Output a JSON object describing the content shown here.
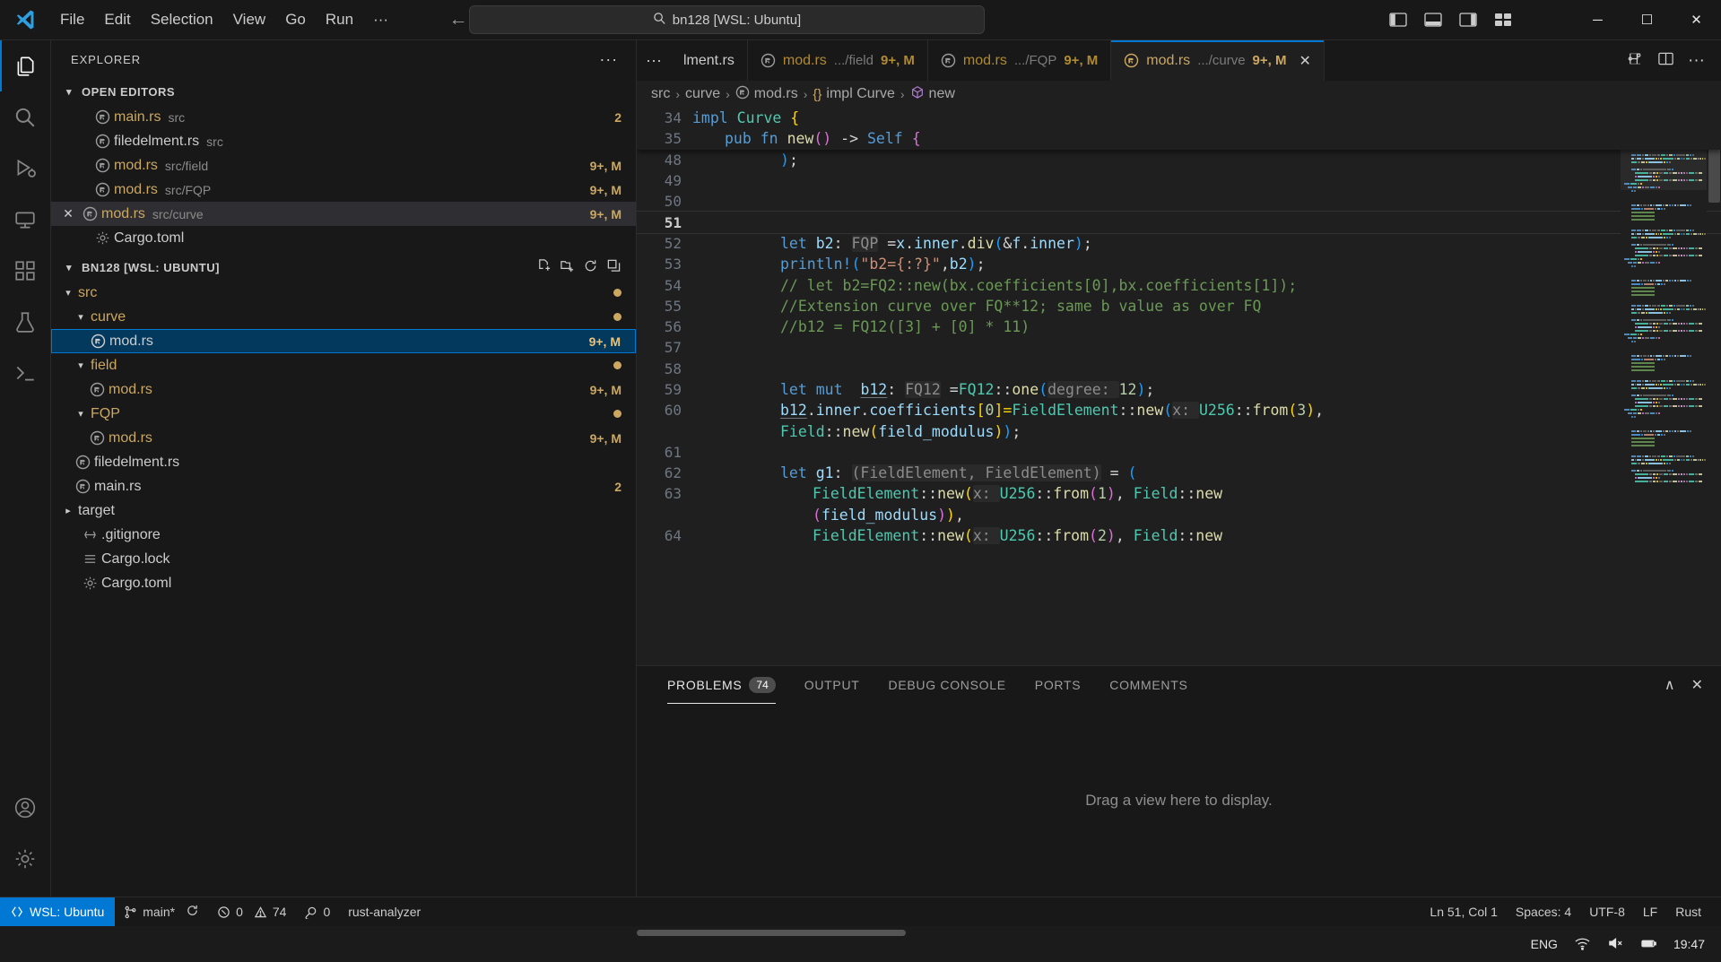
{
  "titlebar": {
    "menus": [
      "File",
      "Edit",
      "Selection",
      "View",
      "Go",
      "Run",
      "···"
    ],
    "back_icon": "←",
    "forward_icon": "→",
    "search_placeholder": "bn128 [WSL: Ubuntu]",
    "search_value": "bn128 [WSL: Ubuntu]",
    "minimize": "─",
    "maximize": "☐",
    "close": "✕"
  },
  "activitybar": {
    "items": [
      {
        "name": "explorer",
        "icon": "files-icon",
        "active": true
      },
      {
        "name": "search",
        "icon": "search-icon",
        "active": false
      },
      {
        "name": "run-and-debug",
        "icon": "debug-icon",
        "active": false
      },
      {
        "name": "remote-explorer",
        "icon": "remote-icon",
        "active": false
      },
      {
        "name": "extensions",
        "icon": "extensions-icon",
        "active": false
      },
      {
        "name": "testing",
        "icon": "beaker-icon",
        "active": false
      },
      {
        "name": "terminal",
        "icon": "terminal-icon",
        "active": false
      }
    ],
    "bottom": [
      {
        "name": "accounts",
        "icon": "account-icon"
      },
      {
        "name": "manage",
        "icon": "gear-icon"
      }
    ]
  },
  "sidebar": {
    "title": "EXPLORER",
    "more_actions": "···",
    "open_editors": {
      "label": "OPEN EDITORS",
      "items": [
        {
          "name": "main.rs",
          "path": "src",
          "badge": "2",
          "selected": false,
          "dirty": false
        },
        {
          "name": "filedelment.rs",
          "path": "src",
          "badge": "",
          "selected": false,
          "dirty": false
        },
        {
          "name": "mod.rs",
          "path": "src/field",
          "badge": "9+, M",
          "selected": false,
          "dirty": false
        },
        {
          "name": "mod.rs",
          "path": "src/FQP",
          "badge": "9+, M",
          "selected": false,
          "dirty": false
        },
        {
          "name": "mod.rs",
          "path": "src/curve",
          "badge": "9+, M",
          "selected": true,
          "dirty": false
        },
        {
          "name": "Cargo.toml",
          "path": "",
          "badge": "",
          "selected": false,
          "dirty": false
        }
      ]
    },
    "workspace": {
      "label": "BN128 [WSL: UBUNTU]",
      "actions": [
        "new-file-icon",
        "new-folder-icon",
        "refresh-icon",
        "collapse-all-icon"
      ],
      "tree": [
        {
          "name": "src",
          "type": "folder",
          "depth": 0,
          "expanded": true,
          "badge": "",
          "dot": true,
          "selected": false
        },
        {
          "name": "curve",
          "type": "folder",
          "depth": 1,
          "expanded": true,
          "badge": "",
          "dot": true,
          "selected": false
        },
        {
          "name": "mod.rs",
          "type": "file",
          "depth": 2,
          "expanded": false,
          "badge": "9+, M",
          "dot": false,
          "selected": true
        },
        {
          "name": "field",
          "type": "folder",
          "depth": 1,
          "expanded": true,
          "badge": "",
          "dot": true,
          "selected": false
        },
        {
          "name": "mod.rs",
          "type": "file",
          "depth": 2,
          "expanded": false,
          "badge": "9+, M",
          "dot": false,
          "selected": false
        },
        {
          "name": "FQP",
          "type": "folder",
          "depth": 1,
          "expanded": true,
          "badge": "",
          "dot": true,
          "selected": false
        },
        {
          "name": "mod.rs",
          "type": "file",
          "depth": 2,
          "expanded": false,
          "badge": "9+, M",
          "dot": false,
          "selected": false
        },
        {
          "name": "filedelment.rs",
          "type": "file",
          "depth": 1,
          "expanded": false,
          "badge": "",
          "dot": false,
          "selected": false
        },
        {
          "name": "main.rs",
          "type": "file",
          "depth": 1,
          "expanded": false,
          "badge": "2",
          "dot": false,
          "selected": false
        },
        {
          "name": "target",
          "type": "folder",
          "depth": 0,
          "expanded": false,
          "badge": "",
          "dot": false,
          "selected": false
        },
        {
          "name": ".gitignore",
          "type": "git",
          "depth": 0,
          "expanded": false,
          "badge": "",
          "dot": false,
          "selected": false
        },
        {
          "name": "Cargo.lock",
          "type": "lock",
          "depth": 0,
          "expanded": false,
          "badge": "",
          "dot": false,
          "selected": false
        },
        {
          "name": "Cargo.toml",
          "type": "toml",
          "depth": 0,
          "expanded": false,
          "badge": "",
          "dot": false,
          "selected": false
        }
      ]
    }
  },
  "tabs": {
    "overflow_icon": "···",
    "items": [
      {
        "name": "lment.rs",
        "path": "",
        "badge": "",
        "active": false,
        "truncated": true
      },
      {
        "name": "mod.rs",
        "path": ".../field",
        "badge": "9+, M",
        "active": false,
        "truncated": false
      },
      {
        "name": "mod.rs",
        "path": ".../FQP",
        "badge": "9+, M",
        "active": false,
        "truncated": false
      },
      {
        "name": "mod.rs",
        "path": ".../curve",
        "badge": "9+, M",
        "active": true,
        "truncated": false
      }
    ],
    "actions": [
      "split-editor-icon",
      "editor-layout-icon",
      "more-actions-icon"
    ],
    "close_icon": "✕"
  },
  "breadcrumb": {
    "items": [
      {
        "label": "src",
        "icon": ""
      },
      {
        "label": "curve",
        "icon": ""
      },
      {
        "label": "mod.rs",
        "icon": "rust-icon"
      },
      {
        "label": "impl Curve",
        "icon": "braces-icon"
      },
      {
        "label": "new",
        "icon": "method-icon"
      }
    ],
    "separator": "›"
  },
  "editor": {
    "sticky_lines": [
      {
        "num": "34",
        "indent": 0,
        "tokens": [
          {
            "t": "impl ",
            "c": "kw"
          },
          {
            "t": "Curve",
            "c": "ty"
          },
          {
            "t": " ",
            "c": "op"
          },
          {
            "t": "{",
            "c": "pn1"
          }
        ]
      },
      {
        "num": "35",
        "indent": 1,
        "tokens": [
          {
            "t": "pub ",
            "c": "kw"
          },
          {
            "t": "fn ",
            "c": "kw"
          },
          {
            "t": "new",
            "c": "fn"
          },
          {
            "t": "()",
            "c": "pn2"
          },
          {
            "t": " -> ",
            "c": "op"
          },
          {
            "t": "Self",
            "c": "kw"
          },
          {
            "t": " ",
            "c": "op"
          },
          {
            "t": "{",
            "c": "pn2"
          }
        ]
      }
    ],
    "lines": [
      {
        "num": "48",
        "git": true,
        "current": false,
        "indent": 2,
        "tokens": [
          {
            "t": ")",
            "c": "pn3"
          },
          {
            "t": ";",
            "c": "op"
          }
        ]
      },
      {
        "num": "49",
        "git": true,
        "current": false,
        "indent": 2,
        "tokens": []
      },
      {
        "num": "50",
        "git": true,
        "current": false,
        "indent": 2,
        "tokens": []
      },
      {
        "num": "51",
        "git": false,
        "current": true,
        "indent": 2,
        "tokens": []
      },
      {
        "num": "52",
        "git": true,
        "current": false,
        "indent": 2,
        "tokens": [
          {
            "t": "let ",
            "c": "kw"
          },
          {
            "t": "b2",
            "c": "var"
          },
          {
            "t": ": ",
            "c": "op"
          },
          {
            "t": "FQP",
            "c": "hint"
          },
          {
            "t": " =",
            "c": "op"
          },
          {
            "t": "x",
            "c": "var"
          },
          {
            "t": ".",
            "c": "op"
          },
          {
            "t": "inner",
            "c": "var"
          },
          {
            "t": ".",
            "c": "op"
          },
          {
            "t": "div",
            "c": "fn"
          },
          {
            "t": "(",
            "c": "pn3"
          },
          {
            "t": "&",
            "c": "op"
          },
          {
            "t": "f",
            "c": "var"
          },
          {
            "t": ".",
            "c": "op"
          },
          {
            "t": "inner",
            "c": "var"
          },
          {
            "t": ")",
            "c": "pn3"
          },
          {
            "t": ";",
            "c": "op"
          }
        ]
      },
      {
        "num": "53",
        "git": true,
        "current": false,
        "indent": 2,
        "tokens": [
          {
            "t": "println!",
            "c": "mac"
          },
          {
            "t": "(",
            "c": "pn3"
          },
          {
            "t": "\"b2={:?}\"",
            "c": "str"
          },
          {
            "t": ",",
            "c": "op"
          },
          {
            "t": "b2",
            "c": "var"
          },
          {
            "t": ")",
            "c": "pn3"
          },
          {
            "t": ";",
            "c": "op"
          }
        ]
      },
      {
        "num": "54",
        "git": true,
        "current": false,
        "indent": 2,
        "tokens": [
          {
            "t": "// let b2=FQ2::new(bx.coefficients[0],bx.coefficients[1]);",
            "c": "cmt"
          }
        ]
      },
      {
        "num": "55",
        "git": true,
        "current": false,
        "indent": 2,
        "tokens": [
          {
            "t": "//Extension curve over FQ**12; same b value as over FQ",
            "c": "cmt"
          }
        ]
      },
      {
        "num": "56",
        "git": true,
        "current": false,
        "indent": 2,
        "tokens": [
          {
            "t": "//b12 = FQ12([3] + [0] * 11)",
            "c": "cmt"
          }
        ]
      },
      {
        "num": "57",
        "git": true,
        "current": false,
        "indent": 2,
        "tokens": []
      },
      {
        "num": "58",
        "git": true,
        "current": false,
        "indent": 2,
        "tokens": []
      },
      {
        "num": "59",
        "git": true,
        "current": false,
        "indent": 2,
        "tokens": [
          {
            "t": "let ",
            "c": "kw"
          },
          {
            "t": "mut ",
            "c": "kw"
          },
          {
            "t": " ",
            "c": "op"
          },
          {
            "t": "b12",
            "c": "var ul"
          },
          {
            "t": ": ",
            "c": "op"
          },
          {
            "t": "FQ12",
            "c": "hint"
          },
          {
            "t": " =",
            "c": "op"
          },
          {
            "t": "FQ12",
            "c": "ty"
          },
          {
            "t": "::",
            "c": "op"
          },
          {
            "t": "one",
            "c": "fn"
          },
          {
            "t": "(",
            "c": "pn3"
          },
          {
            "t": "degree: ",
            "c": "hint"
          },
          {
            "t": "12",
            "c": "num"
          },
          {
            "t": ")",
            "c": "pn3"
          },
          {
            "t": ";",
            "c": "op"
          }
        ]
      },
      {
        "num": "60",
        "git": true,
        "current": false,
        "indent": 2,
        "tokens": [
          {
            "t": "b12",
            "c": "var ul"
          },
          {
            "t": ".",
            "c": "op"
          },
          {
            "t": "inner",
            "c": "var"
          },
          {
            "t": ".",
            "c": "op"
          },
          {
            "t": "coefficients",
            "c": "var"
          },
          {
            "t": "[",
            "c": "pn1"
          },
          {
            "t": "0",
            "c": "num"
          },
          {
            "t": "]=",
            "c": "pn1"
          },
          {
            "t": "FieldElement",
            "c": "ty"
          },
          {
            "t": "::",
            "c": "op"
          },
          {
            "t": "new",
            "c": "fn"
          },
          {
            "t": "(",
            "c": "pn3"
          },
          {
            "t": "x: ",
            "c": "hint"
          },
          {
            "t": "U256",
            "c": "ty"
          },
          {
            "t": "::",
            "c": "op"
          },
          {
            "t": "from",
            "c": "fn"
          },
          {
            "t": "(",
            "c": "pn1"
          },
          {
            "t": "3",
            "c": "num"
          },
          {
            "t": ")",
            "c": "pn1"
          },
          {
            "t": ",",
            "c": "op"
          }
        ]
      },
      {
        "num": "",
        "git": true,
        "current": false,
        "indent": 2,
        "tokens": [
          {
            "t": "Field",
            "c": "ty"
          },
          {
            "t": "::",
            "c": "op"
          },
          {
            "t": "new",
            "c": "fn"
          },
          {
            "t": "(",
            "c": "pn1"
          },
          {
            "t": "field_modulus",
            "c": "var"
          },
          {
            "t": ")",
            "c": "pn1"
          },
          {
            "t": ")",
            "c": "pn3"
          },
          {
            "t": ";",
            "c": "op"
          }
        ]
      },
      {
        "num": "61",
        "git": true,
        "current": false,
        "indent": 2,
        "tokens": []
      },
      {
        "num": "62",
        "git": true,
        "current": false,
        "indent": 2,
        "tokens": [
          {
            "t": "let ",
            "c": "kw"
          },
          {
            "t": "g1",
            "c": "var"
          },
          {
            "t": ": ",
            "c": "op"
          },
          {
            "t": "(FieldElement, FieldElement)",
            "c": "hint"
          },
          {
            "t": " = ",
            "c": "op"
          },
          {
            "t": "(",
            "c": "pn3"
          }
        ]
      },
      {
        "num": "63",
        "git": true,
        "current": false,
        "indent": 3,
        "tokens": [
          {
            "t": "FieldElement",
            "c": "ty"
          },
          {
            "t": "::",
            "c": "op"
          },
          {
            "t": "new",
            "c": "fn"
          },
          {
            "t": "(",
            "c": "pn1"
          },
          {
            "t": "x: ",
            "c": "hint"
          },
          {
            "t": "U256",
            "c": "ty"
          },
          {
            "t": "::",
            "c": "op"
          },
          {
            "t": "from",
            "c": "fn"
          },
          {
            "t": "(",
            "c": "pn2"
          },
          {
            "t": "1",
            "c": "num"
          },
          {
            "t": ")",
            "c": "pn2"
          },
          {
            "t": ", ",
            "c": "op"
          },
          {
            "t": "Field",
            "c": "ty"
          },
          {
            "t": "::",
            "c": "op"
          },
          {
            "t": "new",
            "c": "fn"
          }
        ]
      },
      {
        "num": "",
        "git": true,
        "current": false,
        "indent": 3,
        "tokens": [
          {
            "t": "(",
            "c": "pn2"
          },
          {
            "t": "field_modulus",
            "c": "var"
          },
          {
            "t": ")",
            "c": "pn2"
          },
          {
            "t": ")",
            "c": "pn1"
          },
          {
            "t": ",",
            "c": "op"
          }
        ]
      },
      {
        "num": "64",
        "git": true,
        "current": false,
        "indent": 3,
        "tokens": [
          {
            "t": "FieldElement",
            "c": "ty"
          },
          {
            "t": "::",
            "c": "op"
          },
          {
            "t": "new",
            "c": "fn"
          },
          {
            "t": "(",
            "c": "pn1"
          },
          {
            "t": "x: ",
            "c": "hint"
          },
          {
            "t": "U256",
            "c": "ty"
          },
          {
            "t": "::",
            "c": "op"
          },
          {
            "t": "from",
            "c": "fn"
          },
          {
            "t": "(",
            "c": "pn2"
          },
          {
            "t": "2",
            "c": "num"
          },
          {
            "t": ")",
            "c": "pn2"
          },
          {
            "t": ", ",
            "c": "op"
          },
          {
            "t": "Field",
            "c": "ty"
          },
          {
            "t": "::",
            "c": "op"
          },
          {
            "t": "new",
            "c": "fn"
          }
        ]
      }
    ]
  },
  "panel": {
    "tabs": [
      {
        "label": "PROBLEMS",
        "badge": "74",
        "active": true
      },
      {
        "label": "OUTPUT",
        "badge": "",
        "active": false
      },
      {
        "label": "DEBUG CONSOLE",
        "badge": "",
        "active": false
      },
      {
        "label": "PORTS",
        "badge": "",
        "active": false
      },
      {
        "label": "COMMENTS",
        "badge": "",
        "active": false
      }
    ],
    "collapse_icon": "∧",
    "close_icon": "✕",
    "empty_message": "Drag a view here to display."
  },
  "statusbar": {
    "remote": "WSL: Ubuntu",
    "branch": "main*",
    "sync_icon": "sync-icon",
    "errors": "0",
    "warnings": "74",
    "ports": "0",
    "language_server": "rust-analyzer",
    "cursor": "Ln 51, Col 1",
    "spaces": "Spaces: 4",
    "encoding": "UTF-8",
    "eol": "LF",
    "language": "Rust"
  },
  "taskbar": {
    "lang": "ENG",
    "time": "19:47",
    "icons": [
      "wifi-icon",
      "volume-mute-icon",
      "battery-icon"
    ]
  },
  "colors": {
    "accent": "#0078d4",
    "dirty_yellow": "#cba762",
    "git_added": "#2ea043",
    "selection_blue": "#04395e",
    "error_red": "#c42b1c"
  }
}
